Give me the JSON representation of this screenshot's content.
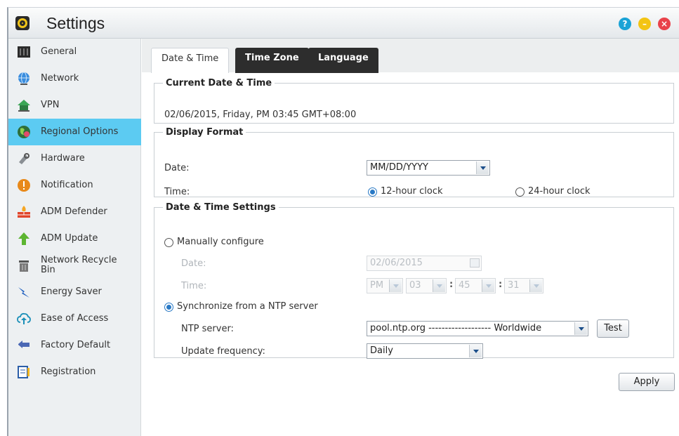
{
  "window": {
    "title": "Settings",
    "help": "?",
    "minimize": "–",
    "close": "×"
  },
  "colors": {
    "accent": "#5ccbf2",
    "tab_dark": "#2d2d2d",
    "radio_on": "#2979c5"
  },
  "sidebar": {
    "items": [
      {
        "label": "General",
        "icon": "general-icon"
      },
      {
        "label": "Network",
        "icon": "globe-icon"
      },
      {
        "label": "VPN",
        "icon": "vpn-icon"
      },
      {
        "label": "Regional Options",
        "icon": "regional-globe-icon"
      },
      {
        "label": "Hardware",
        "icon": "hardware-icon"
      },
      {
        "label": "Notification",
        "icon": "notification-icon"
      },
      {
        "label": "ADM Defender",
        "icon": "firewall-icon"
      },
      {
        "label": "ADM Update",
        "icon": "update-arrow-icon"
      },
      {
        "label": "Network Recycle Bin",
        "icon": "recycle-bin-icon"
      },
      {
        "label": "Energy Saver",
        "icon": "energy-saver-icon"
      },
      {
        "label": "Ease of Access",
        "icon": "cloud-access-icon"
      },
      {
        "label": "Factory Default",
        "icon": "undo-arrow-icon"
      },
      {
        "label": "Registration",
        "icon": "registration-icon"
      }
    ],
    "active": "Regional Options"
  },
  "tabs": [
    {
      "label": "Date & Time",
      "active": true
    },
    {
      "label": "Time Zone",
      "active": false
    },
    {
      "label": "Language",
      "active": false
    }
  ],
  "current": {
    "legend": "Current Date & Time",
    "value": "02/06/2015, Friday, PM 03:45 GMT+08:00"
  },
  "display_format": {
    "legend": "Display Format",
    "date_label": "Date:",
    "date_value": "MM/DD/YYYY",
    "time_label": "Time:",
    "opt_12": "12-hour clock",
    "opt_24": "24-hour clock",
    "selected": "12-hour clock"
  },
  "settings": {
    "legend": "Date & Time Settings",
    "manual_label": "Manually configure",
    "date_label": "Date:",
    "date_value": "02/06/2015",
    "time_label": "Time:",
    "ampm": "PM",
    "hour": "03",
    "minute": "45",
    "second": "31",
    "colon": ":",
    "ntp_label": "Synchronize from a NTP server",
    "ntp_server_label": "NTP server:",
    "ntp_server_value": "pool.ntp.org ------------------- Worldwide",
    "test_label": "Test",
    "freq_label": "Update frequency:",
    "freq_value": "Daily",
    "selected": "ntp"
  },
  "apply_label": "Apply"
}
